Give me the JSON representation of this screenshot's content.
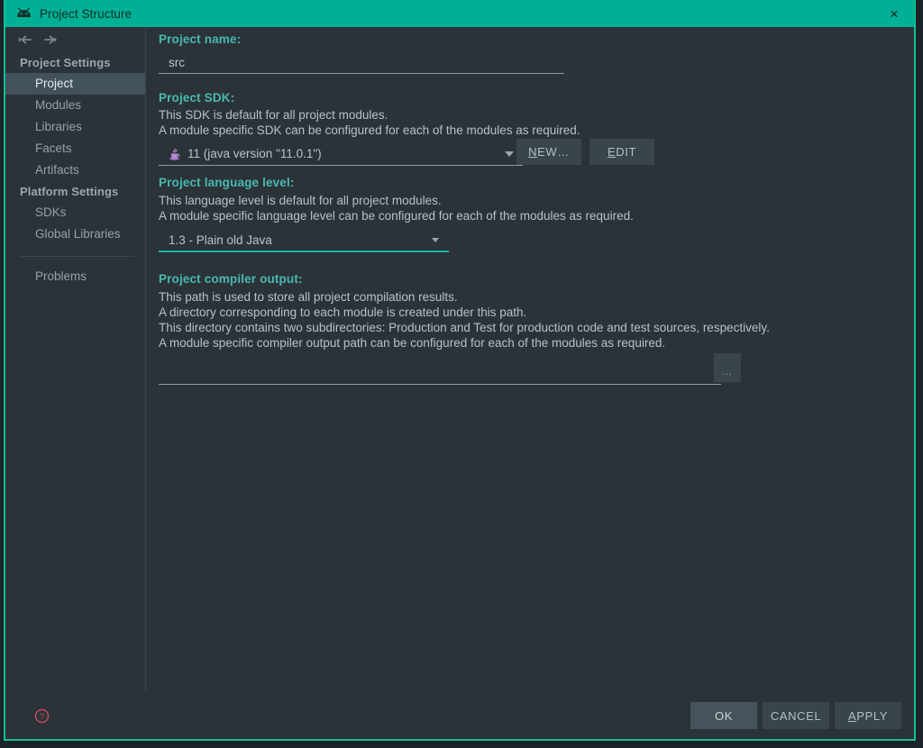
{
  "window": {
    "title": "Project Structure",
    "app_icon": "android-studio-icon",
    "close_label": "×",
    "border_color": "#0fbf93",
    "titlebar_color": "#00b094"
  },
  "nav": {
    "back_label": "back-arrow",
    "forward_label": "forward-arrow"
  },
  "sidebar": {
    "groups": [
      {
        "title": "Project Settings",
        "items": [
          {
            "label": "Project",
            "selected": true
          },
          {
            "label": "Modules",
            "selected": false
          },
          {
            "label": "Libraries",
            "selected": false
          },
          {
            "label": "Facets",
            "selected": false
          },
          {
            "label": "Artifacts",
            "selected": false
          }
        ]
      },
      {
        "title": "Platform Settings",
        "items": [
          {
            "label": "SDKs",
            "selected": false
          },
          {
            "label": "Global Libraries",
            "selected": false
          }
        ]
      }
    ],
    "problems_label": "Problems"
  },
  "main": {
    "project_name": {
      "heading": "Project name:",
      "value": "src"
    },
    "project_sdk": {
      "heading": "Project SDK:",
      "desc_line1": "This SDK is default for all project modules.",
      "desc_line2": "A module specific SDK can be configured for each of the modules as required.",
      "selected": "11 (java version \"11.0.1\")",
      "sdk_icon": "java-sdk-icon",
      "new_button": {
        "mnemonic": "N",
        "rest": "EW…"
      },
      "edit_button": {
        "mnemonic": "E",
        "rest": "DIT"
      }
    },
    "language_level": {
      "heading": "Project language level:",
      "desc_line1": "This language level is default for all project modules.",
      "desc_line2": "A module specific language level can be configured for each of the modules as required.",
      "selected": "1.3 - Plain old Java"
    },
    "compiler_output": {
      "heading": "Project compiler output:",
      "desc_line1": "This path is used to store all project compilation results.",
      "desc_line2": "A directory corresponding to each module is created under this path.",
      "desc_line3": "This directory contains two subdirectories: Production and Test for production code and test sources, respectively.",
      "desc_line4": "A module specific compiler output path can be configured for each of the modules as required.",
      "path_value": "",
      "browse_label": "…"
    }
  },
  "footer": {
    "help_label": "?",
    "help_color": "#c94a5e",
    "ok_button": "OK",
    "cancel_button": "CANCEL",
    "apply_button": {
      "mnemonic": "A",
      "rest": "PPLY"
    }
  }
}
